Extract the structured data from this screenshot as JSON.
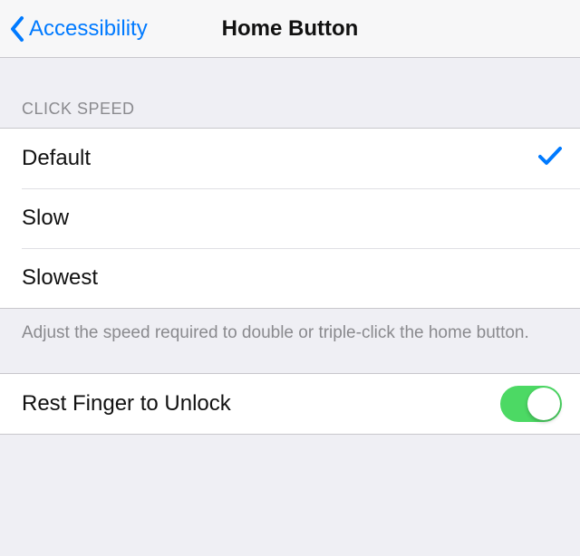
{
  "nav": {
    "back_label": "Accessibility",
    "title": "Home Button"
  },
  "sections": {
    "click_speed": {
      "header": "CLICK SPEED",
      "options": [
        {
          "label": "Default",
          "selected": true
        },
        {
          "label": "Slow",
          "selected": false
        },
        {
          "label": "Slowest",
          "selected": false
        }
      ],
      "footer": "Adjust the speed required to double or triple-click the home button."
    },
    "rest_finger": {
      "label": "Rest Finger to Unlock",
      "enabled": true
    }
  },
  "colors": {
    "accent": "#007aff",
    "switch_on": "#4cd964"
  }
}
